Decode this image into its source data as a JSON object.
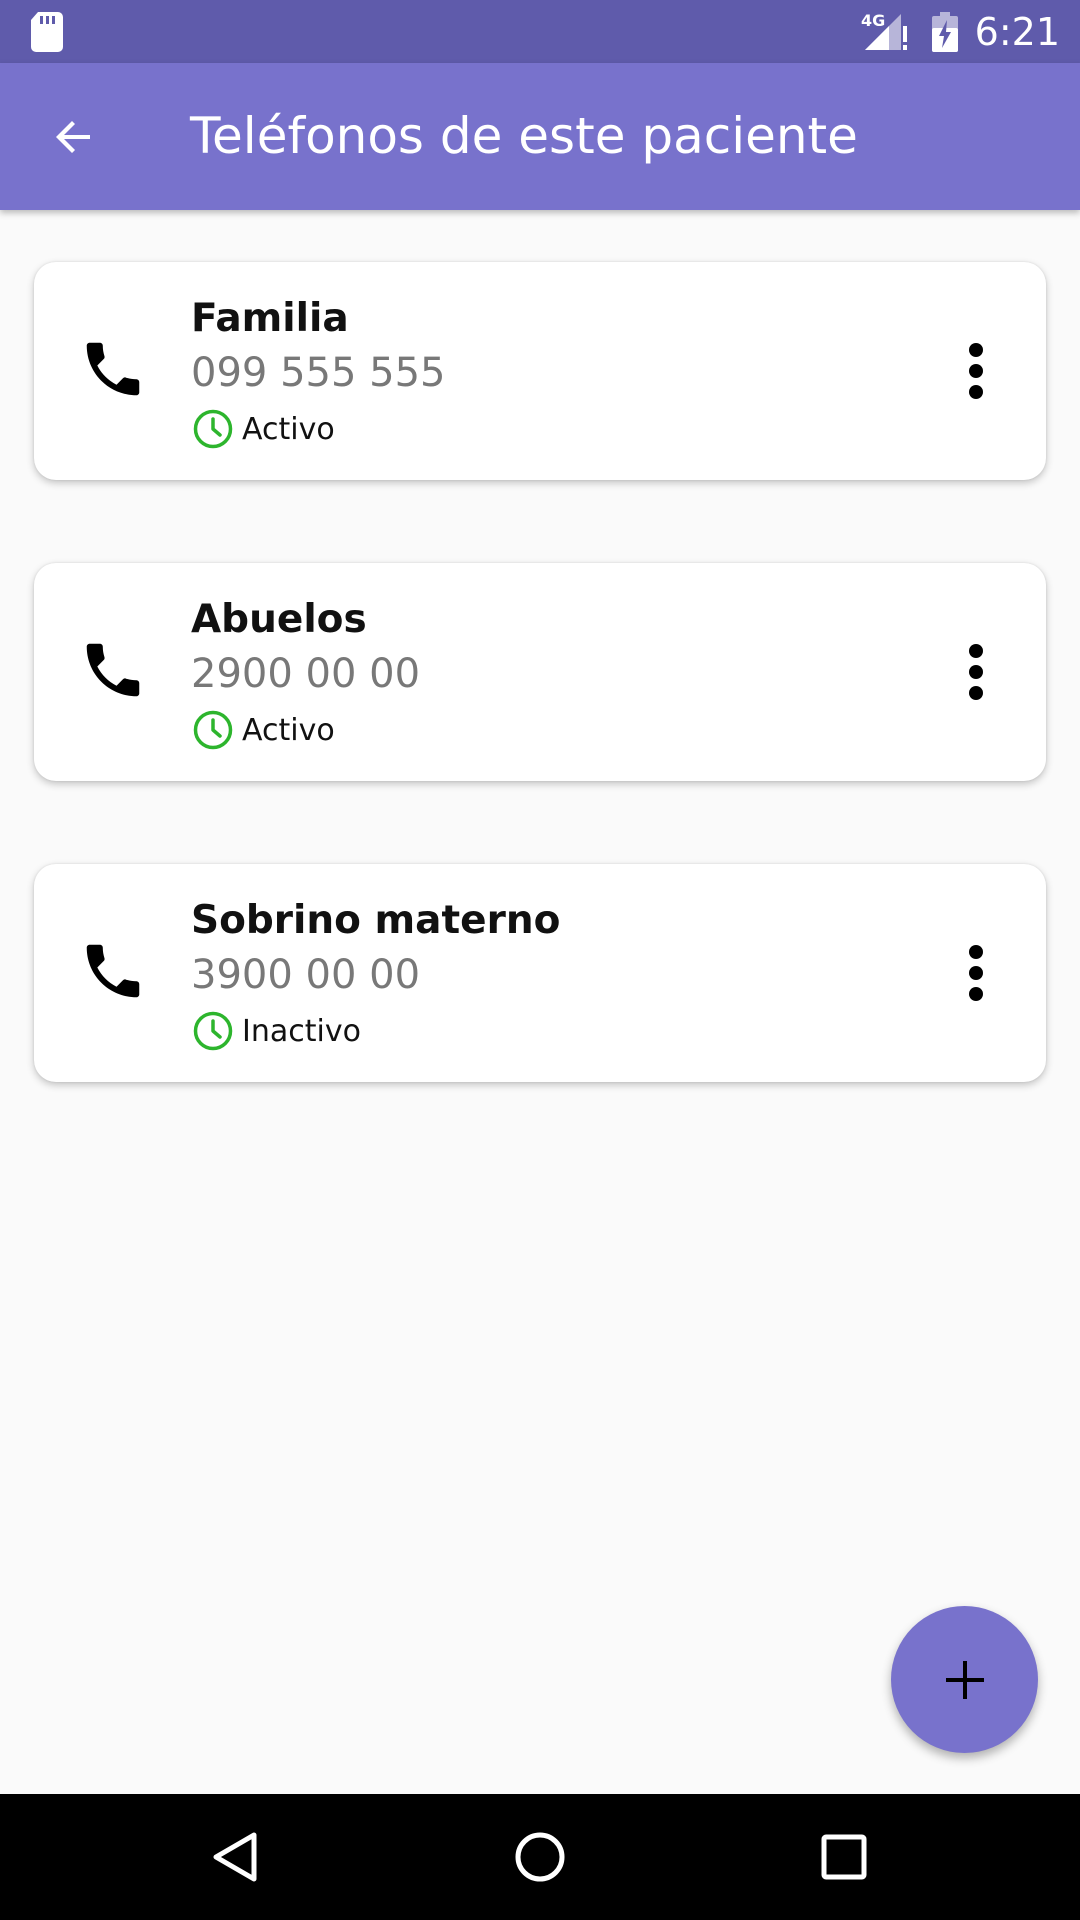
{
  "status_bar": {
    "time": "6:21",
    "network": "4G",
    "icons": [
      "sd-card-icon",
      "signal-4g-alert-icon",
      "battery-charging-icon"
    ]
  },
  "app_bar": {
    "title": "Teléfonos de este paciente",
    "back_icon": "arrow-back-icon",
    "background": "#7872cc"
  },
  "contacts": [
    {
      "name": "Familia",
      "number": "099 555 555",
      "status": "Activo"
    },
    {
      "name": "Abuelos",
      "number": "2900 00 00",
      "status": "Activo"
    },
    {
      "name": "Sobrino materno",
      "number": "3900 00 00",
      "status": "Inactivo"
    }
  ],
  "colors": {
    "accent": "#7872cc",
    "status_bar": "#5f5bab",
    "status_icon": "#2db52d",
    "number_text": "#787878"
  },
  "fab": {
    "icon": "plus-icon"
  },
  "nav_bar": {
    "buttons": [
      "back-triangle-icon",
      "home-circle-icon",
      "recents-square-icon"
    ]
  }
}
